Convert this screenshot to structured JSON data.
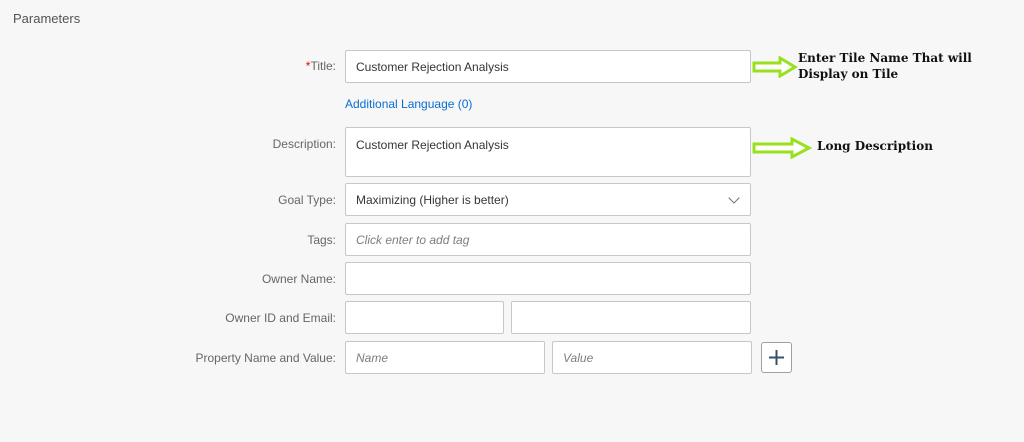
{
  "section": {
    "title": "Parameters"
  },
  "form": {
    "title": {
      "required_mark": "*",
      "label": "Title:",
      "value": "Customer Rejection Analysis"
    },
    "additional_language_link": "Additional Language (0)",
    "description": {
      "label": "Description:",
      "value": "Customer Rejection Analysis"
    },
    "goal_type": {
      "label": "Goal Type:",
      "value": "Maximizing (Higher is better)"
    },
    "tags": {
      "label": "Tags:",
      "placeholder": "Click enter to add tag"
    },
    "owner_name": {
      "label": "Owner Name:",
      "value": ""
    },
    "owner_id_email": {
      "label": "Owner ID and Email:",
      "id_value": "",
      "email_value": ""
    },
    "property": {
      "label": "Property Name and Value:",
      "name_placeholder": "Name",
      "value_placeholder": "Value"
    },
    "add_button_icon": "plus-icon"
  },
  "annotations": {
    "tile_name": "Enter Tile Name That will Display on Tile",
    "long_description": "Long Description",
    "arrow_color": "#99e01e"
  }
}
